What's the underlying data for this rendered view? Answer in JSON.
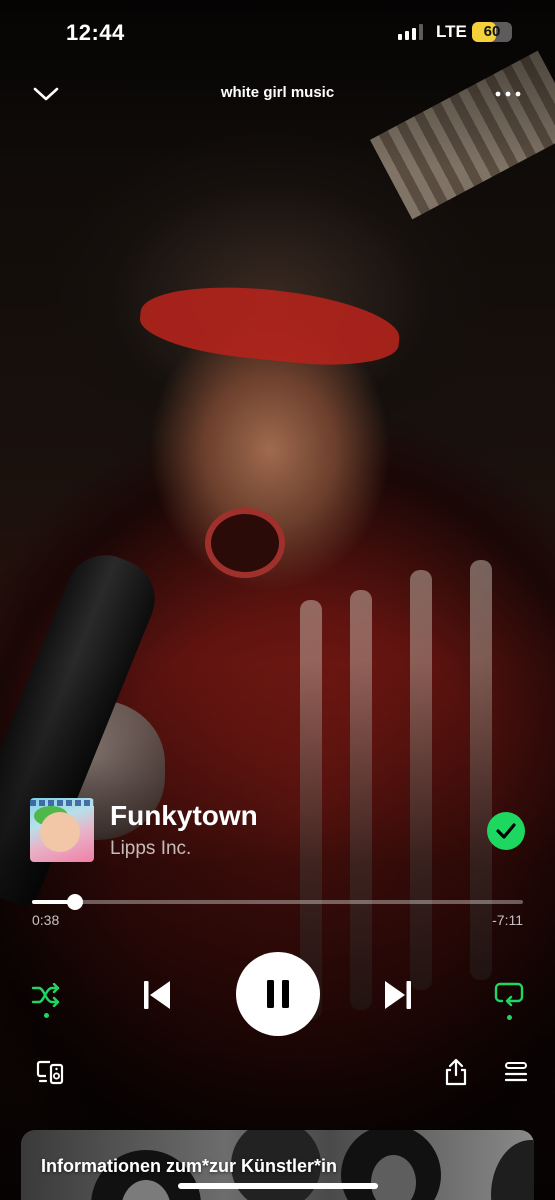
{
  "status_bar": {
    "time": "12:44",
    "network": "LTE",
    "battery": "60",
    "battery_level": 0.6
  },
  "header": {
    "playlist_title": "white girl music",
    "collapse_icon": "chevron-down-icon",
    "more_icon": "more-dots-icon"
  },
  "track": {
    "title": "Funkytown",
    "artist": "Lipps Inc.",
    "liked": true
  },
  "playback": {
    "elapsed": "0:38",
    "remaining": "-7:11",
    "progress": 0.088,
    "is_playing": true,
    "shuffle_on": true,
    "repeat_on": true
  },
  "bottom_actions": {
    "devices_icon": "connect-device-icon",
    "share_icon": "share-icon",
    "queue_icon": "queue-icon"
  },
  "artist_card": {
    "title": "Informationen zum*zur Künstler*in"
  },
  "colors": {
    "accent": "#1ed760",
    "battery": "#f4d03a",
    "text": "#ffffff"
  }
}
